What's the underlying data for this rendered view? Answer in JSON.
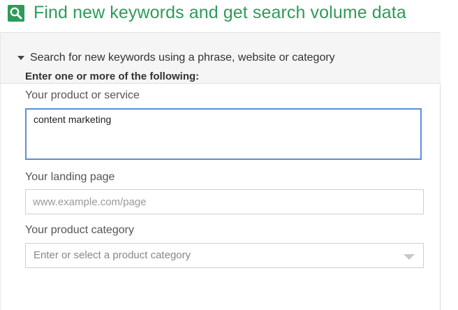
{
  "header": {
    "icon": "search-icon",
    "title": "Find new keywords and get search volume data",
    "accent_color": "#2e9b5a"
  },
  "section": {
    "caret_icon": "caret-down-icon",
    "title": "Search for new keywords using a phrase, website or category"
  },
  "form": {
    "intro": "Enter one or more of the following:",
    "product": {
      "label": "Your product or service",
      "value": "content marketing"
    },
    "landing": {
      "label": "Your landing page",
      "value": "",
      "placeholder": "www.example.com/page"
    },
    "category": {
      "label": "Your product category",
      "placeholder": "Enter or select a product category",
      "icon": "dropdown-arrow-icon"
    }
  }
}
